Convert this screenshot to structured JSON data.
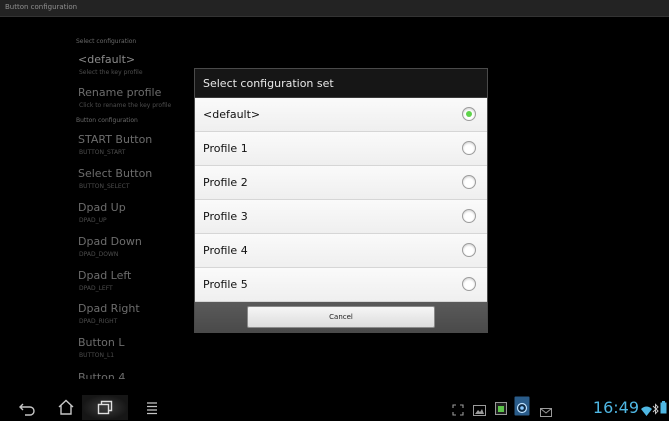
{
  "window": {
    "title": "Button configuration"
  },
  "settings": {
    "header_select": "Select configuration",
    "header_buttons": "Button configuration",
    "items": [
      {
        "title": "<default>",
        "subtitle": "Select the key profile"
      },
      {
        "title": "Rename profile",
        "subtitle": "Click to rename the key profile"
      },
      {
        "title": "START Button",
        "subtitle": "BUTTON_START"
      },
      {
        "title": "Select Button",
        "subtitle": "BUTTON_SELECT"
      },
      {
        "title": "Dpad Up",
        "subtitle": "DPAD_UP"
      },
      {
        "title": "Dpad Down",
        "subtitle": "DPAD_DOWN"
      },
      {
        "title": "Dpad Left",
        "subtitle": "DPAD_LEFT"
      },
      {
        "title": "Dpad Right",
        "subtitle": "DPAD_RIGHT"
      },
      {
        "title": "Button L",
        "subtitle": "BUTTON_L1"
      },
      {
        "title": "Button 4",
        "subtitle": ""
      }
    ]
  },
  "dialog": {
    "title": "Select configuration set",
    "options": [
      {
        "label": "<default>",
        "selected": true
      },
      {
        "label": "Profile 1",
        "selected": false
      },
      {
        "label": "Profile 2",
        "selected": false
      },
      {
        "label": "Profile 3",
        "selected": false
      },
      {
        "label": "Profile 4",
        "selected": false
      },
      {
        "label": "Profile 5",
        "selected": false
      }
    ],
    "cancel_label": "Cancel"
  },
  "navbar": {
    "icons": [
      "back-icon",
      "home-icon",
      "recent-apps-icon",
      "menu-icon"
    ],
    "status_icons": [
      "screen-compat-icon",
      "gallery-icon",
      "sd-card-icon",
      "camera-icon",
      "mail-icon",
      "wifi-icon",
      "bluetooth-icon",
      "battery-icon"
    ],
    "clock": "16:49",
    "accent_color": "#4fb7e3"
  }
}
